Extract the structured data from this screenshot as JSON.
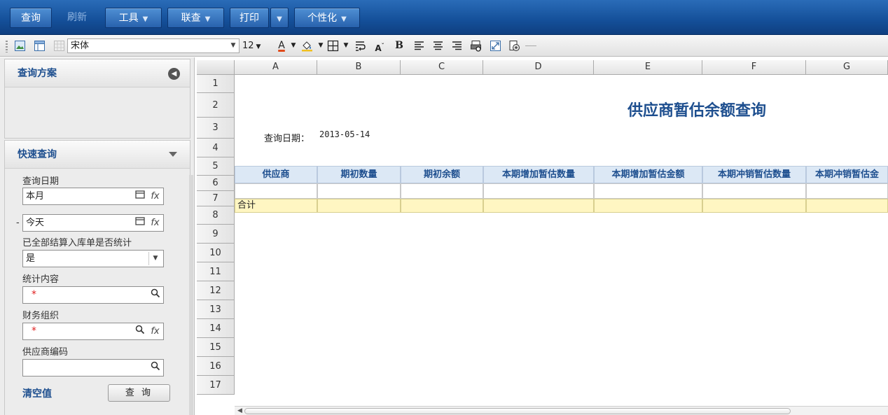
{
  "toolbar": {
    "query": "查询",
    "refresh": "刷新",
    "tools": "工具",
    "linked_query": "联查",
    "print": "打印",
    "personalize": "个性化"
  },
  "format_bar": {
    "font_name": "宋体",
    "font_size": "12"
  },
  "left_panel": {
    "scheme_title": "查询方案",
    "quick_title": "快速查询",
    "fields": {
      "query_date_label": "查询日期",
      "date_from": "本月",
      "date_to": "今天",
      "settled_label": "已全部结算入库单是否统计",
      "settled_value": "是",
      "stat_content_label": "统计内容",
      "stat_content_value": "*",
      "finance_org_label": "财务组织",
      "finance_org_value": "*",
      "supplier_code_label": "供应商编码",
      "supplier_code_value": "",
      "fx": "fx",
      "dash": "-"
    },
    "clear_label": "清空值",
    "query_button": "查 询"
  },
  "sheet": {
    "columns": [
      "A",
      "B",
      "C",
      "D",
      "E",
      "F",
      "G"
    ],
    "rows": [
      "1",
      "2",
      "3",
      "4",
      "5",
      "6",
      "7",
      "8",
      "9",
      "10",
      "11",
      "12",
      "13",
      "14",
      "15",
      "16",
      "17"
    ],
    "report_title": "供应商暂估余额查询",
    "date_label": "查询日期：",
    "date_value": "2013-05-14",
    "headers": [
      "供应商",
      "期初数量",
      "期初余额",
      "本期增加暂估数量",
      "本期增加暂估金额",
      "本期冲销暂估数量",
      "本期冲销暂估金"
    ],
    "total_label": "合计"
  },
  "colors": {
    "accent": "#1e4f8f",
    "topbar": "#144f99",
    "header_cell": "#dce8f5",
    "total_row": "#fff6c2"
  }
}
